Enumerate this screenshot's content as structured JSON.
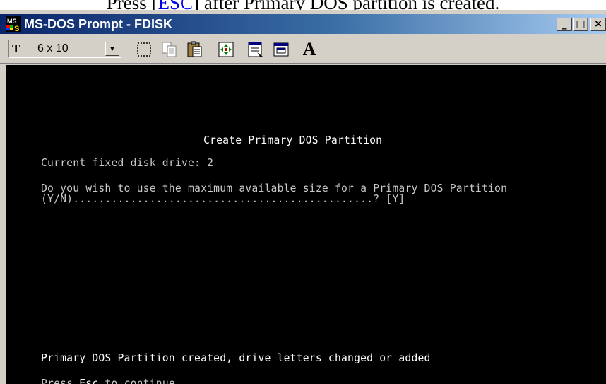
{
  "caption": {
    "before": "Press [",
    "link": "ESC",
    "after": "] after Primary DOS partition is created."
  },
  "window": {
    "title": "MS-DOS Prompt - FDISK",
    "icon": "ms-dos-icon",
    "controls": {
      "minimize": "_",
      "maximize": "□",
      "close": "×"
    }
  },
  "toolbar": {
    "font_size": "6 x 10",
    "font_icon": "truetype-font-icon",
    "tools": [
      "mark-icon",
      "copy-icon",
      "paste-icon",
      "full-screen-icon",
      "properties-icon",
      "background-icon",
      "font-icon"
    ],
    "font_button_label": "A"
  },
  "console": {
    "heading": "Create Primary DOS Partition",
    "drive_line": "Current fixed disk drive: 2",
    "question_line1": "Do you wish to use the maximum available size for a Primary DOS Partition",
    "question_line2": "(Y/N)...............................................? [Y]",
    "status_line": "Primary DOS Partition created, drive letters changed or added",
    "continue_prefix": "Press ",
    "continue_key": "Esc",
    "continue_suffix": " to continue"
  }
}
